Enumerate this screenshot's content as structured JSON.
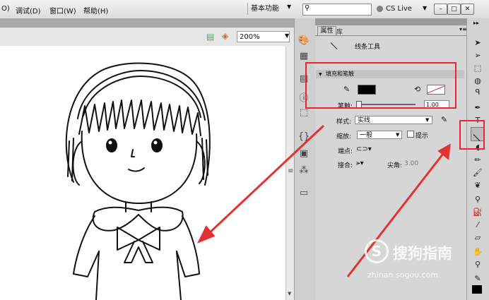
{
  "menu": {
    "items": [
      "O)",
      "调试(D)",
      "窗口(W)",
      "帮助(H)"
    ],
    "workspace_label": "基本功能",
    "search_placeholder": "",
    "cslive_label": "CS Live"
  },
  "stage": {
    "zoom_value": "200%"
  },
  "panel": {
    "tab_properties": "属性",
    "tab_library": "库",
    "tool_name": "线条工具",
    "section_title": "填充和笔触",
    "stroke_label": "笔触:",
    "stroke_value": "1.00",
    "style_label": "样式:",
    "style_value": "实线",
    "scale_label": "缩放:",
    "scale_value": "一般",
    "hint_label": "提示",
    "cap_label": "端点:",
    "join_label": "接合:",
    "miter_label": "尖角:",
    "miter_value": "3.00",
    "stroke_color": "#000000"
  },
  "watermark": {
    "text": "搜狗指南",
    "url": "zhinan.sogou.com"
  },
  "colors": {
    "annotation": "#e23333"
  },
  "icons": [
    "search-icon",
    "pencil-icon",
    "paint-bucket-icon",
    "line-tool-icon",
    "selection-tool-icon"
  ]
}
